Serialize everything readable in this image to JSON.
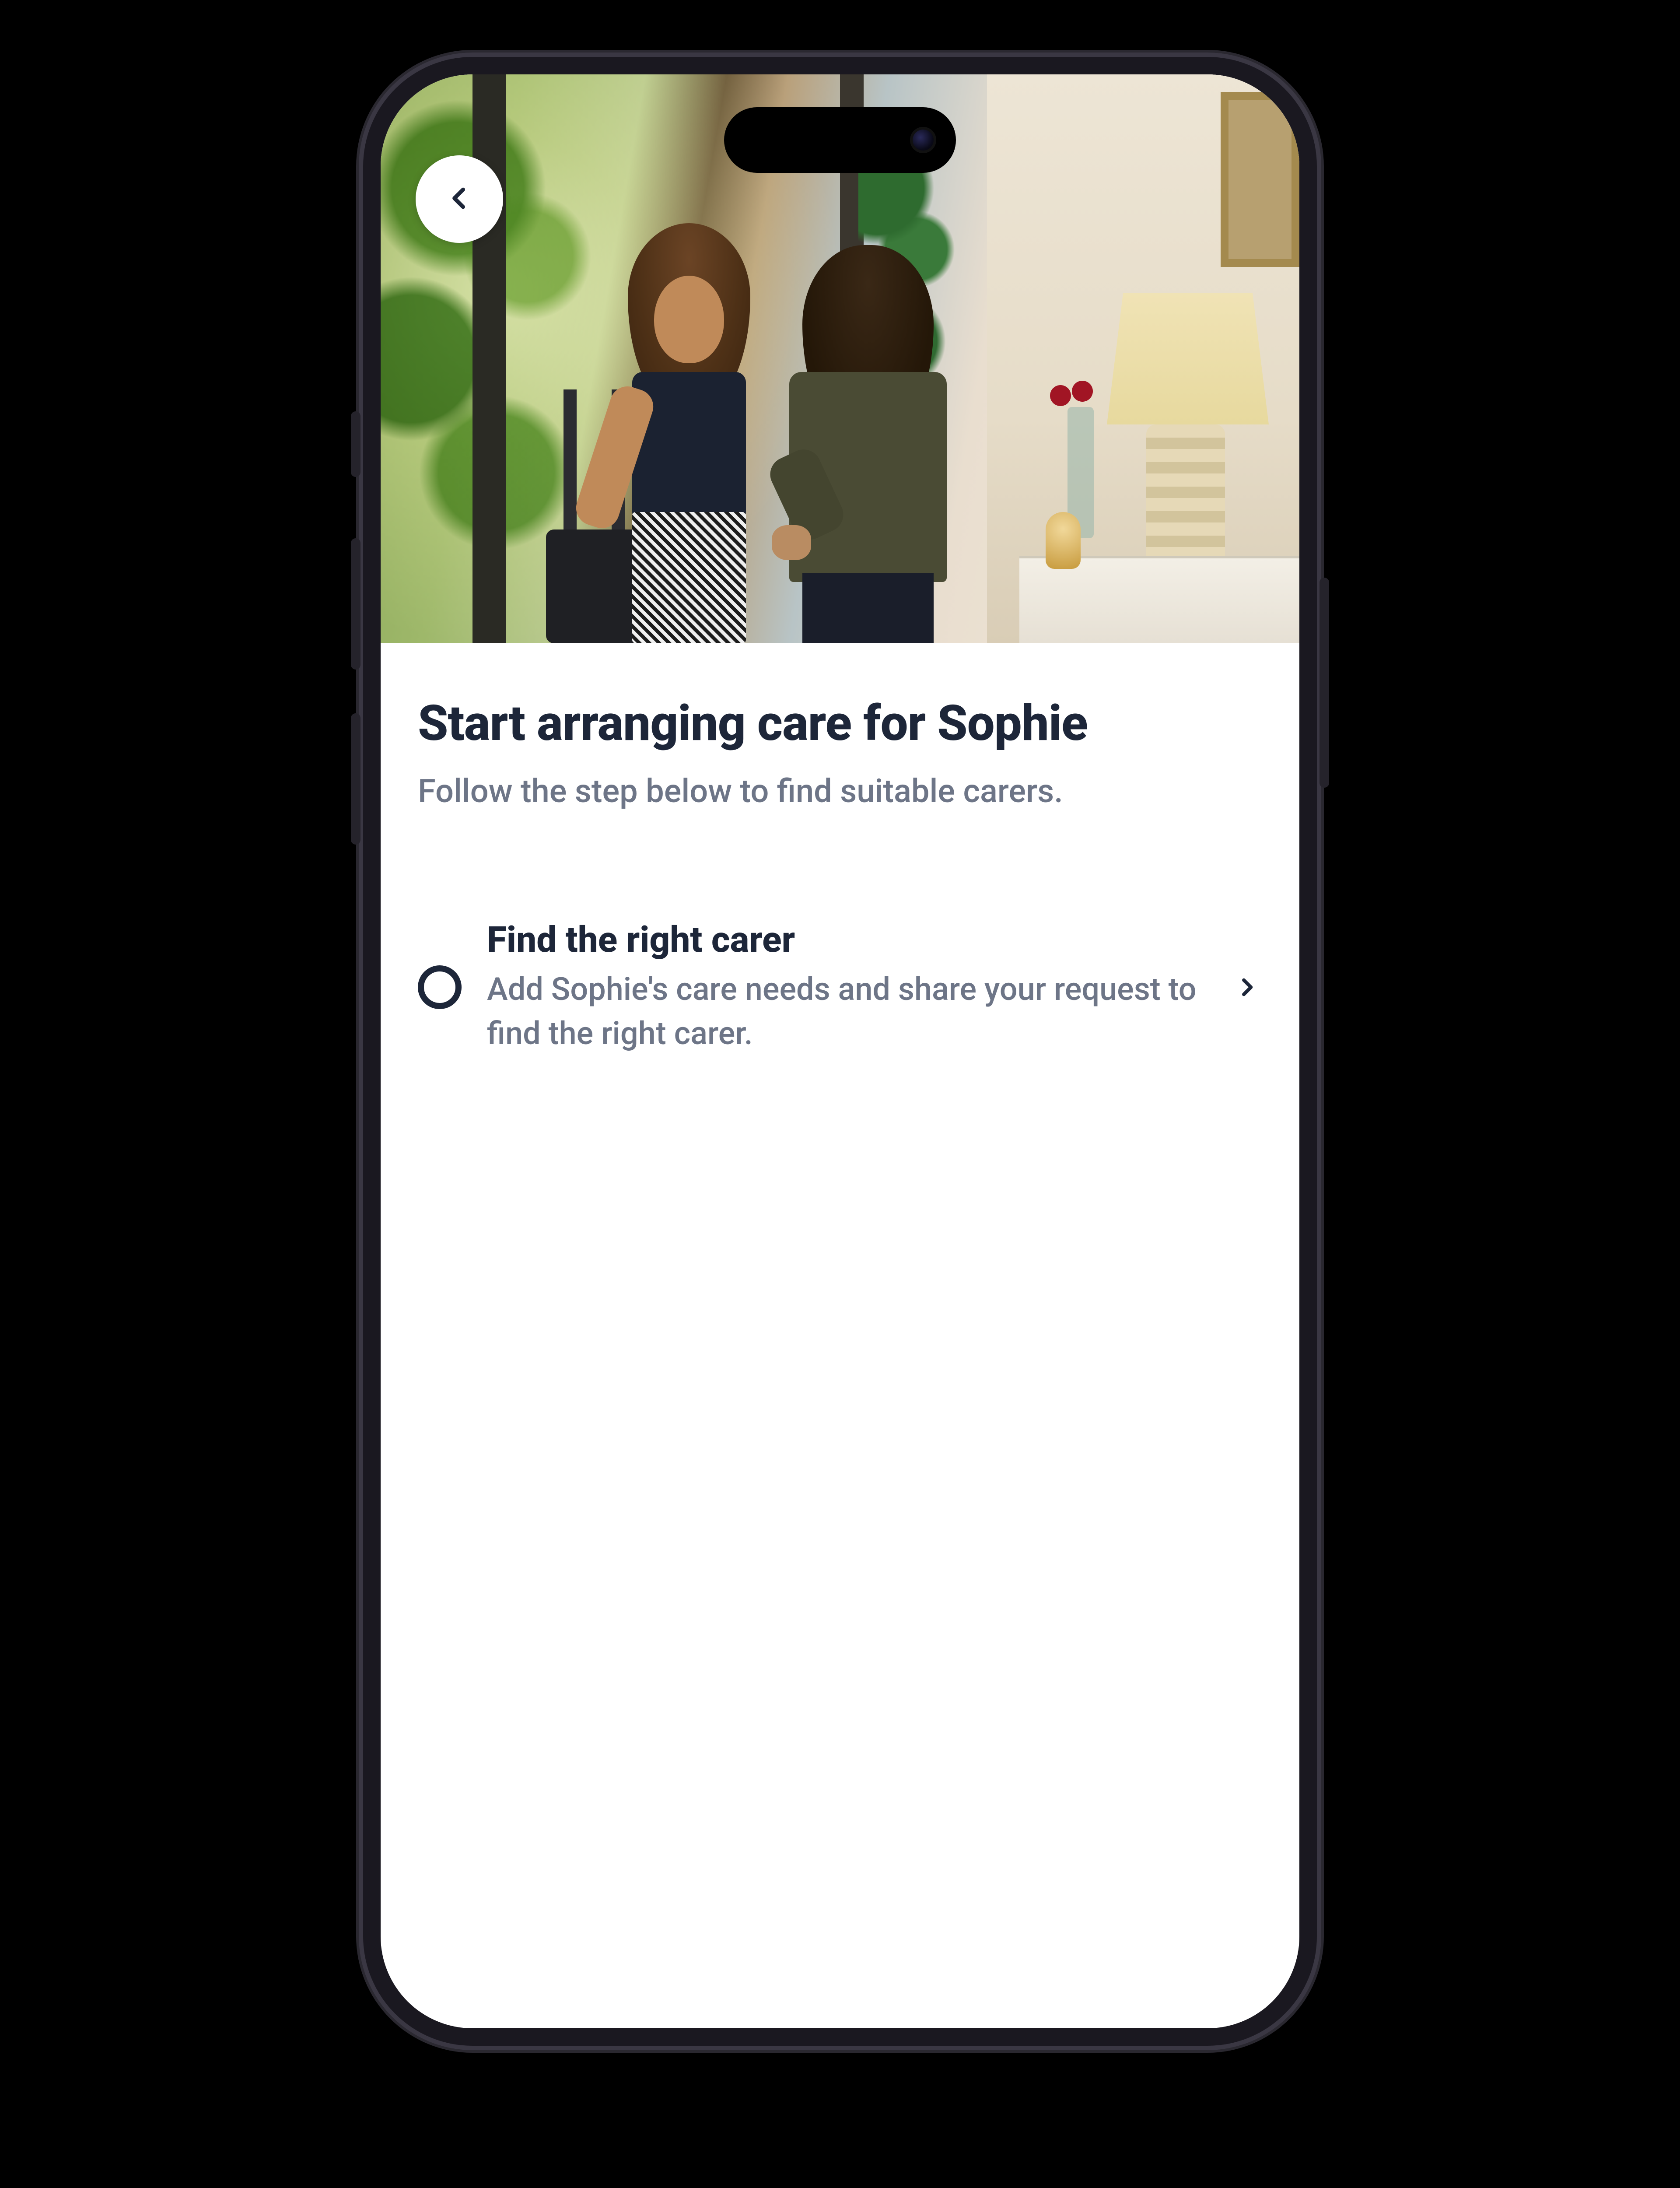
{
  "header": {
    "back_aria": "Back"
  },
  "main": {
    "title": "Start arranging care for Sophie",
    "subtitle": "Follow the step below to find suitable carers."
  },
  "step": {
    "title": "Find the right carer",
    "description": "Add Sophie's care needs and share your request to find the right carer."
  },
  "colors": {
    "text_primary": "#1d2639",
    "text_secondary": "#6d7587",
    "surface": "#ffffff"
  }
}
